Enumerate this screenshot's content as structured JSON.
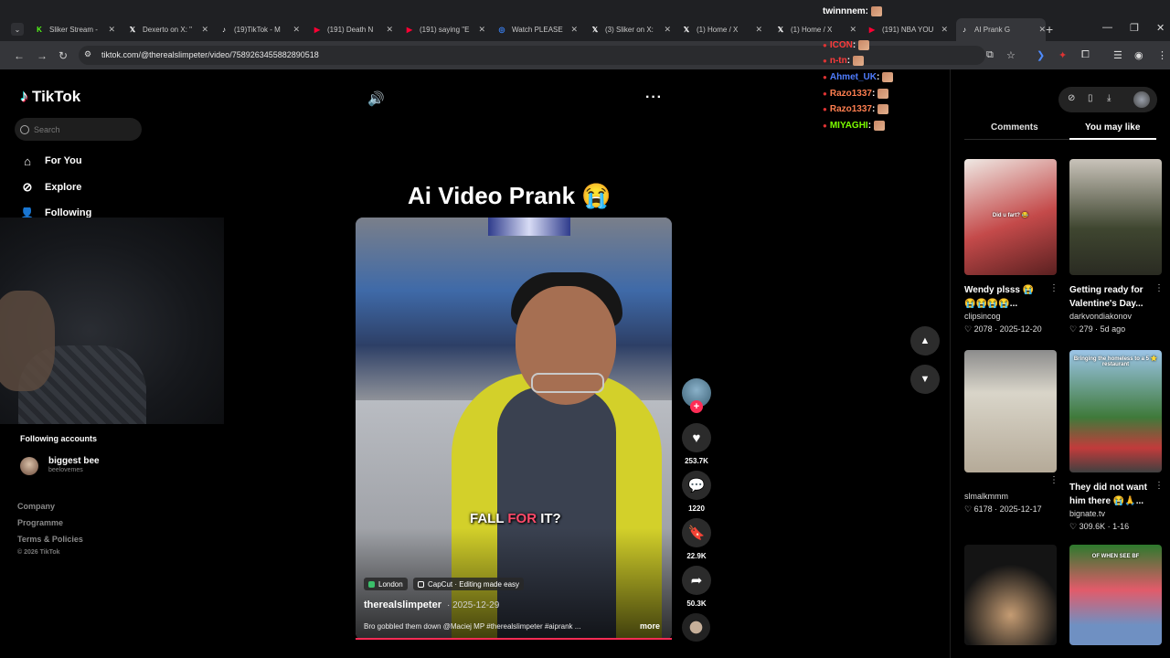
{
  "browser": {
    "tabs": [
      {
        "label": "Sliker Stream -",
        "icon": "kick-icon",
        "color": "#53fc18"
      },
      {
        "label": "Dexerto on X: \"",
        "icon": "x-icon",
        "color": "#ffffff"
      },
      {
        "label": "(19)TikTok - M",
        "icon": "tiktok-icon",
        "color": "#ffffff"
      },
      {
        "label": "(191) Death N",
        "icon": "youtube-icon",
        "color": "#ff0033"
      },
      {
        "label": "(191) saying \"E",
        "icon": "youtube-icon",
        "color": "#ff0033"
      },
      {
        "label": "Watch PLEASE",
        "icon": "site-icon",
        "color": "#3b82f6"
      },
      {
        "label": "(3) Sliker on X:",
        "icon": "x-icon",
        "color": "#ffffff"
      },
      {
        "label": "(1) Home / X",
        "icon": "x-icon",
        "color": "#ffffff"
      },
      {
        "label": "(1) Home / X",
        "icon": "x-icon",
        "color": "#ffffff"
      },
      {
        "label": "(191) NBA YOU",
        "icon": "youtube-icon",
        "color": "#ff0033"
      },
      {
        "label": "AI Prank G",
        "icon": "tiktok-icon",
        "color": "#ffffff"
      }
    ],
    "url": "tiktok.com/@therealslimpeter/video/7589263455882890518"
  },
  "chat": [
    {
      "user": "twinnnem",
      "color": "#ffffff"
    },
    {
      "user": "ICON",
      "color": "#ff3b3b"
    },
    {
      "user": "n-tn",
      "color": "#ff3b3b"
    },
    {
      "user": "Ahmet_UK",
      "color": "#4f7dff"
    },
    {
      "user": "Razo1337",
      "color": "#ff7f50"
    },
    {
      "user": "Razo1337",
      "color": "#ff7f50"
    },
    {
      "user": "MIYAGHI",
      "color": "#7cfc00"
    }
  ],
  "sidebar": {
    "logo": "TikTok",
    "search_placeholder": "Search",
    "nav": [
      {
        "label": "For You",
        "icon": "home-icon"
      },
      {
        "label": "Explore",
        "icon": "compass-icon"
      },
      {
        "label": "Following",
        "icon": "user-icon"
      }
    ],
    "following_title": "Following accounts",
    "accounts": [
      {
        "name": "biggest bee",
        "handle": "beelovemes"
      }
    ],
    "footer": [
      "Company",
      "Programme",
      "Terms & Policies"
    ],
    "copyright": "© 2026 TikTok"
  },
  "video": {
    "title": "Ai Video Prank 😭",
    "caption_white": "FALL ",
    "caption_red": "FOR",
    "caption_end": " IT?",
    "location": "London",
    "capcut": "CapCut · Editing made easy",
    "author": "therealslimpeter",
    "date": "· 2025-12-29",
    "description": "Bro gobbled them down @Maciej MP #therealslimpeter #aiprank ...",
    "more": "more",
    "progress": 1.0,
    "likes": "253.7K",
    "comments": "1220",
    "saves": "22.9K",
    "shares": "50.3K"
  },
  "panel": {
    "tab_comments": "Comments",
    "tab_like": "You may like",
    "items": [
      {
        "title": "Wendy plsss 😭 😭😭😭😭...",
        "author": "clipsincog",
        "likes": "2078",
        "date": "· 2025-12-20",
        "overlay": "Did u fart? 😂"
      },
      {
        "title": "Getting ready for Valentine's Day...",
        "author": "darkvondiakonov",
        "likes": "279",
        "date": "· 5d ago",
        "overlay": ""
      },
      {
        "title": "",
        "author": "slmalkmmm",
        "likes": "6178",
        "date": "· 2025-12-17",
        "overlay": ""
      },
      {
        "title": "They did not want him there 😭🙏...",
        "author": "bignate.tv",
        "likes": "309.6K",
        "date": "· 1-16",
        "overlay": "Bringing the homeless to a 5 ⭐ restaurant"
      },
      {
        "title": "",
        "author": "",
        "likes": "",
        "date": "",
        "overlay": ""
      },
      {
        "title": "",
        "author": "",
        "likes": "",
        "date": "",
        "overlay": "OF WHEN SEE BF"
      }
    ]
  }
}
